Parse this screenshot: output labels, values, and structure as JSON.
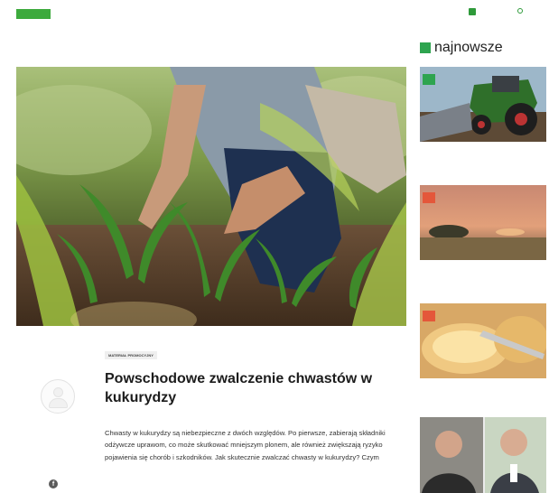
{
  "nav": {
    "logo_badge": "",
    "logo_text": "",
    "items": [
      "",
      "",
      "",
      "",
      "",
      "",
      "",
      "",
      "",
      "",
      "",
      ""
    ],
    "active_index": 5,
    "login_label": "",
    "search_label": ""
  },
  "breadcrumb": "",
  "hero_caption": "",
  "article": {
    "date": "",
    "author": "",
    "share_label": "",
    "badge": "MATERIAŁ PROMOCYJNY",
    "title": "Powschodowe zwalczenie chwastów w kukurydzy",
    "lead": "Chwasty w kukurydzy są niebezpieczne z dwóch względów. Po pierwsze, zabierają składniki odżywcze uprawom, co może skutkować mniejszym plonem, ale również zwiększają ryzyko pojawienia się chorób i szkodników. Jak skutecznie zwalczać chwasty w kukurydzy? Czym"
  },
  "sidebar": {
    "title": "najnowsze",
    "cards": [
      {
        "category": "",
        "title": ""
      },
      {
        "category": "",
        "title": ""
      },
      {
        "category": "",
        "title": ""
      }
    ]
  },
  "colors": {
    "brand_green": "#2ea44f",
    "orange_flag": "#e4573a"
  }
}
